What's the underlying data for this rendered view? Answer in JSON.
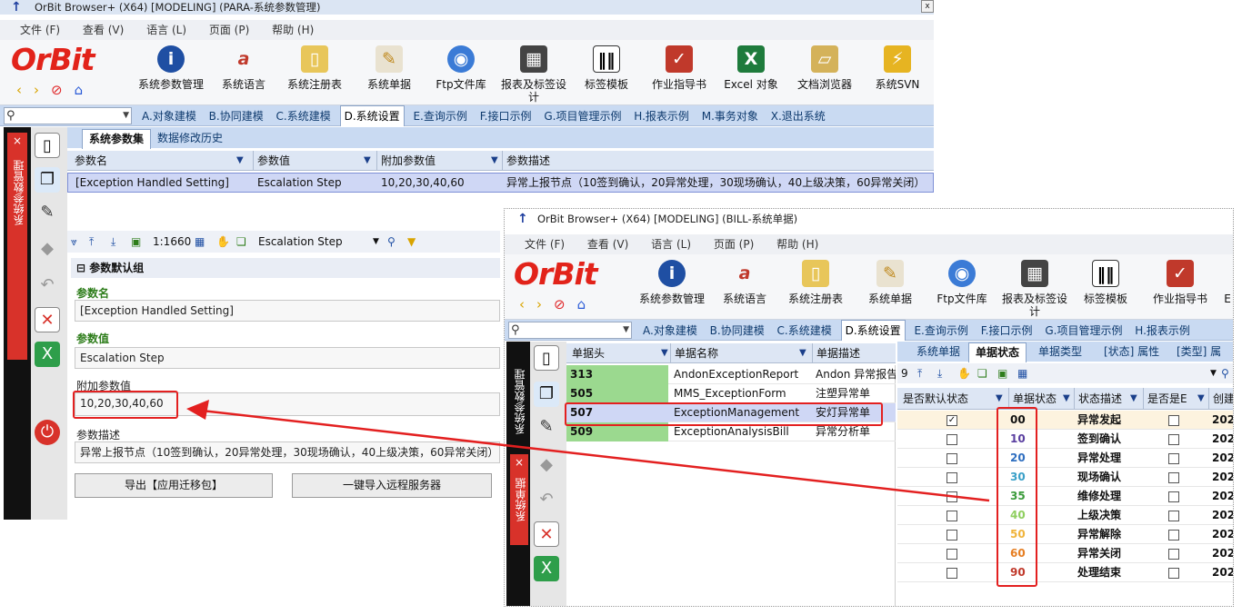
{
  "window1": {
    "title": "OrBit Browser+ (X64) [MODELING] (PARA-系统参数管理)",
    "close_label": "x",
    "menu": [
      "文件 (F)",
      "查看 (V)",
      "语言 (L)",
      "页面 (P)",
      "帮助 (H)"
    ],
    "logo": "OrBit",
    "toolbar": [
      "系统参数管理",
      "系统语言",
      "系统注册表",
      "系统单据",
      "Ftp文件库",
      "报表及标签设计",
      "标签模板",
      "作业指导书",
      "Excel 对象",
      "文档浏览器",
      "系统SVN"
    ],
    "navtabs": [
      "A.对象建模",
      "B.协同建模",
      "C.系统建模",
      "D.系统设置",
      "E.查询示例",
      "F.接口示例",
      "G.项目管理示例",
      "H.报表示例",
      "M.事务对象",
      "X.退出系统"
    ],
    "active_nav": "D.系统设置",
    "sidebar_label": "系统参数管理",
    "sidebar_close": "×",
    "subtabs": [
      "系统参数集",
      "数据修改历史"
    ],
    "grid": {
      "columns": [
        "参数名",
        "参数值",
        "附加参数值",
        "参数描述"
      ],
      "row": [
        "[Exception Handled Setting]",
        "Escalation Step",
        "10,20,30,40,60",
        "异常上报节点（10签到确认，20异常处理，30现场确认，40上级决策，60异常关闭）"
      ]
    },
    "detail_toolbar": {
      "counter": "1:1660",
      "combo": "Escalation Step"
    },
    "group_title": "参数默认组",
    "form": {
      "name_label": "参数名",
      "name_value": "[Exception Handled Setting]",
      "value_label": "参数值",
      "value_value": "Escalation Step",
      "extra_label": "附加参数值",
      "extra_value": "10,20,30,40,60",
      "desc_label": "参数描述",
      "desc_value": "异常上报节点（10签到确认，20异常处理，30现场确认，40上级决策，60异常关闭）"
    },
    "buttons": {
      "export": "导出【应用迁移包】",
      "import": "一键导入远程服务器"
    }
  },
  "window2": {
    "title": "OrBit Browser+ (X64) [MODELING] (BILL-系统单据)",
    "menu": [
      "文件 (F)",
      "查看 (V)",
      "语言 (L)",
      "页面 (P)",
      "帮助 (H)"
    ],
    "logo": "OrBit",
    "toolbar": [
      "系统参数管理",
      "系统语言",
      "系统注册表",
      "系统单据",
      "Ftp文件库",
      "报表及标签设计",
      "标签模板",
      "作业指导书"
    ],
    "toolbar_cut": "E",
    "navtabs": [
      "A.对象建模",
      "B.协同建模",
      "C.系统建模",
      "D.系统设置",
      "E.查询示例",
      "F.接口示例",
      "G.项目管理示例",
      "H.报表示例"
    ],
    "sidebar_label_top": "系统参数管理",
    "sidebar_label_bottom": "系统单据",
    "sidebar_close": "×",
    "left_grid": {
      "columns": [
        "单据头",
        "单据名称",
        "单据描述"
      ],
      "rows": [
        [
          "313",
          "AndonExceptionReport",
          "Andon 异常报告"
        ],
        [
          "505",
          "MMS_ExceptionForm",
          "注塑异常单"
        ],
        [
          "507",
          "ExceptionManagement",
          "安灯异常单"
        ],
        [
          "509",
          "ExceptionAnalysisBill",
          "异常分析单"
        ]
      ]
    },
    "right_tabs": [
      "系统单据",
      "单据状态",
      "单据类型",
      "[状态] 属性",
      "[类型] 属性"
    ],
    "right_count": "9",
    "right_grid": {
      "columns": [
        "是否默认状态",
        "单据状态",
        "状态描述",
        "是否是E",
        "创建"
      ],
      "rows": [
        {
          "code": "00",
          "desc": "异常发起",
          "default": true,
          "year": "202",
          "color": "#111111"
        },
        {
          "code": "10",
          "desc": "签到确认",
          "default": false,
          "year": "202",
          "color": "#5a3fa0"
        },
        {
          "code": "20",
          "desc": "异常处理",
          "default": false,
          "year": "202",
          "color": "#2f6fc0"
        },
        {
          "code": "30",
          "desc": "现场确认",
          "default": false,
          "year": "202",
          "color": "#3aa0c8"
        },
        {
          "code": "35",
          "desc": "维修处理",
          "default": false,
          "year": "202",
          "color": "#3a9b3a"
        },
        {
          "code": "40",
          "desc": "上级决策",
          "default": false,
          "year": "202",
          "color": "#8fcf5f"
        },
        {
          "code": "50",
          "desc": "异常解除",
          "default": false,
          "year": "202",
          "color": "#f0b43c"
        },
        {
          "code": "60",
          "desc": "异常关闭",
          "default": false,
          "year": "202",
          "color": "#e67e22"
        },
        {
          "code": "90",
          "desc": "处理结束",
          "default": false,
          "year": "202",
          "color": "#c0392b"
        }
      ]
    }
  }
}
